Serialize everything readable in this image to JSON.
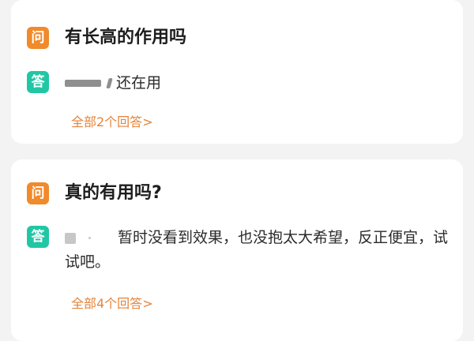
{
  "questions": [
    {
      "q_badge": "问",
      "title": "有长高的作用吗",
      "a_badge": "答",
      "answer": "还在用",
      "all_answers": "全部2个回答",
      "more_arrow": ">"
    },
    {
      "q_badge": "问",
      "title": "真的有用吗?",
      "a_badge": "答",
      "answer": "暂时没看到效果，也没抱太大希望，反正便宜，试试吧。",
      "all_answers": "全部4个回答",
      "more_arrow": ">"
    }
  ],
  "colors": {
    "question_badge": "#f08a2b",
    "answer_badge": "#21c7a4",
    "link": "#e5843a"
  }
}
